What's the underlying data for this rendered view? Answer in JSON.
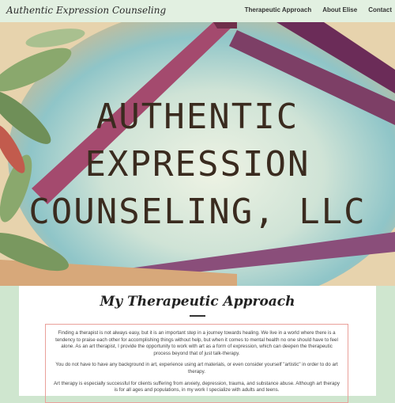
{
  "header": {
    "brand": "Authentic Expression Counseling",
    "nav": [
      {
        "label": "Therapeutic Approach"
      },
      {
        "label": "About Elise"
      },
      {
        "label": "Contact"
      }
    ]
  },
  "hero": {
    "logo_lines": [
      "AUTHENTIC",
      "EXPRESSION",
      "COUNSELING, LLC"
    ]
  },
  "main": {
    "section_title": "My Therapeutic Approach",
    "paragraphs": [
      "Finding a therapist is not always easy, but it is an important step in a journey towards healing. We live in a world where there is a tendency to praise each other for accomplishing things without help, but when it comes to mental health no one should have to feel alone. As an art therapist, I provide the opportunity to work with art as a form of expression, which can deepen the therapeutic process beyond that of just talk-therapy.",
      "You do not have to have any background in art, experience using art materials, or even consider yourself \"artistic\" in order to do art therapy.",
      "Art therapy is especially successful for clients suffering from anxiety, depression, trauma, and substance abuse. Although art therapy is for all ages and populations, in my work I specialize with adults and teens."
    ]
  },
  "colors": {
    "page_bg": "#cfe6cf",
    "header_bg": "#e2f0e1",
    "box_border": "#e9a09a",
    "logo_text": "#3a2b1f"
  }
}
